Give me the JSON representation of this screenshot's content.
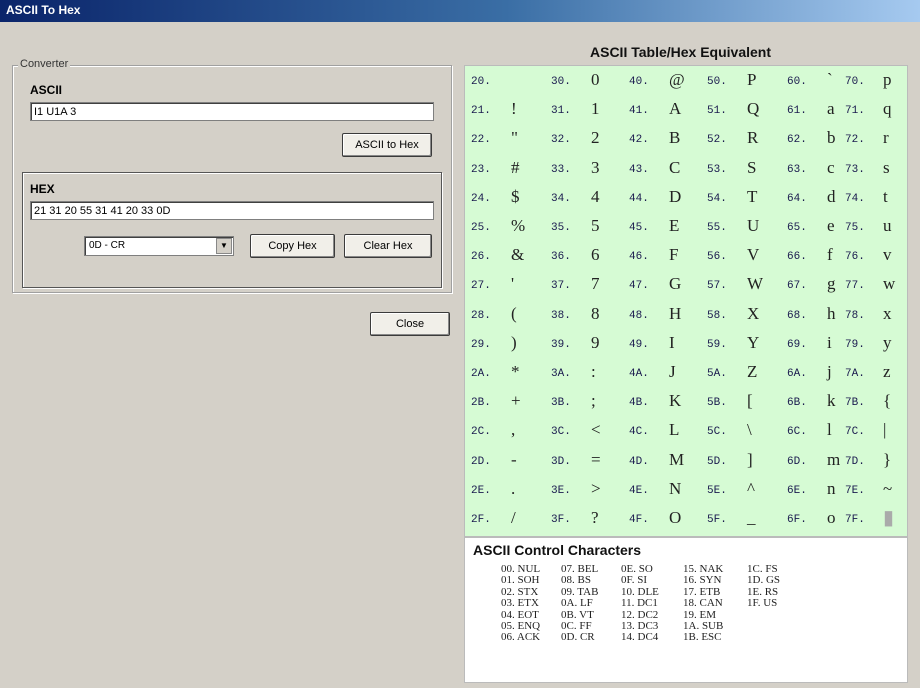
{
  "window": {
    "title": "ASCII To Hex"
  },
  "converter": {
    "legend": "Converter",
    "ascii_label": "ASCII",
    "ascii_value": "I1 U1A 3",
    "ascii_to_hex_button": "ASCII to Hex",
    "hex_label": "HEX",
    "hex_value": "21 31 20 55 31 41 20 33 0D",
    "line_end_select": "0D - CR",
    "copy_hex_button": "Copy Hex",
    "clear_hex_button": "Clear Hex"
  },
  "close_button": "Close",
  "ascii_table": {
    "title": "ASCII Table/Hex Equivalent",
    "columns": [
      [
        [
          "20.",
          ""
        ],
        [
          "21.",
          "!"
        ],
        [
          "22.",
          "\""
        ],
        [
          "23.",
          "#"
        ],
        [
          "24.",
          "$"
        ],
        [
          "25.",
          "%"
        ],
        [
          "26.",
          "&"
        ],
        [
          "27.",
          "'"
        ],
        [
          "28.",
          "("
        ],
        [
          "29.",
          ")"
        ],
        [
          "2A.",
          "*"
        ],
        [
          "2B.",
          "+"
        ],
        [
          "2C.",
          ","
        ],
        [
          "2D.",
          "-"
        ],
        [
          "2E.",
          "."
        ],
        [
          "2F.",
          "/"
        ]
      ],
      [
        [
          "30.",
          "0"
        ],
        [
          "31.",
          "1"
        ],
        [
          "32.",
          "2"
        ],
        [
          "33.",
          "3"
        ],
        [
          "34.",
          "4"
        ],
        [
          "35.",
          "5"
        ],
        [
          "36.",
          "6"
        ],
        [
          "37.",
          "7"
        ],
        [
          "38.",
          "8"
        ],
        [
          "39.",
          "9"
        ],
        [
          "3A.",
          ":"
        ],
        [
          "3B.",
          ";"
        ],
        [
          "3C.",
          "<"
        ],
        [
          "3D.",
          "="
        ],
        [
          "3E.",
          ">"
        ],
        [
          "3F.",
          "?"
        ]
      ],
      [
        [
          "40.",
          "@"
        ],
        [
          "41.",
          "A"
        ],
        [
          "42.",
          "B"
        ],
        [
          "43.",
          "C"
        ],
        [
          "44.",
          "D"
        ],
        [
          "45.",
          "E"
        ],
        [
          "46.",
          "F"
        ],
        [
          "47.",
          "G"
        ],
        [
          "48.",
          "H"
        ],
        [
          "49.",
          "I"
        ],
        [
          "4A.",
          "J"
        ],
        [
          "4B.",
          "K"
        ],
        [
          "4C.",
          "L"
        ],
        [
          "4D.",
          "M"
        ],
        [
          "4E.",
          "N"
        ],
        [
          "4F.",
          "O"
        ]
      ],
      [
        [
          "50.",
          "P"
        ],
        [
          "51.",
          "Q"
        ],
        [
          "52.",
          "R"
        ],
        [
          "53.",
          "S"
        ],
        [
          "54.",
          "T"
        ],
        [
          "55.",
          "U"
        ],
        [
          "56.",
          "V"
        ],
        [
          "57.",
          "W"
        ],
        [
          "58.",
          "X"
        ],
        [
          "59.",
          "Y"
        ],
        [
          "5A.",
          "Z"
        ],
        [
          "5B.",
          "["
        ],
        [
          "5C.",
          "\\"
        ],
        [
          "5D.",
          "]"
        ],
        [
          "5E.",
          "^"
        ],
        [
          "5F.",
          "_"
        ]
      ],
      [
        [
          "60.",
          "`"
        ],
        [
          "61.",
          "a"
        ],
        [
          "62.",
          "b"
        ],
        [
          "63.",
          "c"
        ],
        [
          "64.",
          "d"
        ],
        [
          "65.",
          "e"
        ],
        [
          "66.",
          "f"
        ],
        [
          "67.",
          "g"
        ],
        [
          "68.",
          "h"
        ],
        [
          "69.",
          "i"
        ],
        [
          "6A.",
          "j"
        ],
        [
          "6B.",
          "k"
        ],
        [
          "6C.",
          "l"
        ],
        [
          "6D.",
          "m"
        ],
        [
          "6E.",
          "n"
        ],
        [
          "6F.",
          "o"
        ]
      ],
      [
        [
          "70.",
          "p"
        ],
        [
          "71.",
          "q"
        ],
        [
          "72.",
          "r"
        ],
        [
          "73.",
          "s"
        ],
        [
          "74.",
          "t"
        ],
        [
          "75.",
          "u"
        ],
        [
          "76.",
          "v"
        ],
        [
          "77.",
          "w"
        ],
        [
          "78.",
          "x"
        ],
        [
          "79.",
          "y"
        ],
        [
          "7A.",
          "z"
        ],
        [
          "7B.",
          "{"
        ],
        [
          "7C.",
          "|"
        ],
        [
          "7D.",
          "}"
        ],
        [
          "7E.",
          "~"
        ],
        [
          "7F.",
          "▮"
        ]
      ]
    ]
  },
  "control_chars": {
    "title": "ASCII Control Characters",
    "columns": [
      [
        "00. NUL",
        "01. SOH",
        "02. STX",
        "03. ETX",
        "04. EOT",
        "05. ENQ",
        "06. ACK"
      ],
      [
        "07. BEL",
        "08. BS",
        "09. TAB",
        "0A. LF",
        "0B. VT",
        "0C. FF",
        "0D. CR"
      ],
      [
        "0E. SO",
        "0F. SI",
        "10. DLE",
        "11. DC1",
        "12. DC2",
        "13. DC3",
        "14. DC4"
      ],
      [
        "15. NAK",
        "16. SYN",
        "17. ETB",
        "18. CAN",
        "19. EM",
        "1A. SUB",
        "1B. ESC"
      ],
      [
        "1C. FS",
        "1D. GS",
        "1E. RS",
        "1F. US"
      ]
    ]
  },
  "colors": {
    "table_bg": "#d6fbd4",
    "titlebar": "#0a246a"
  }
}
